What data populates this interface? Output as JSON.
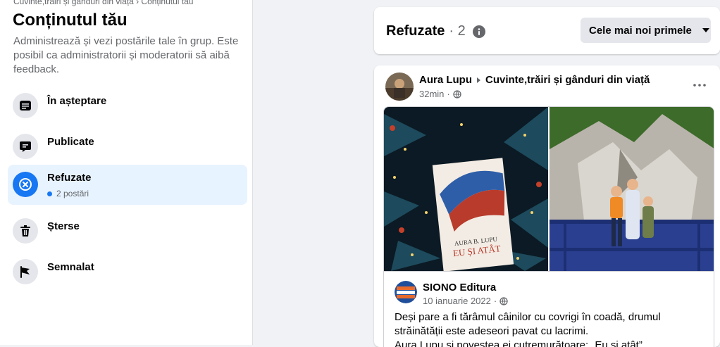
{
  "sidebar": {
    "breadcrumb": "Cuvinte,trăiri și gânduri din viață › Conținutul tău",
    "title": "Conținutul tău",
    "description": "Administrează și vezi postările tale în grup. Este posibil ca administratorii și moderatorii să aibă feedback.",
    "items": [
      {
        "label": "În așteptare",
        "icon": "list-icon"
      },
      {
        "label": "Publicate",
        "icon": "chat-bubble-icon"
      },
      {
        "label": "Refuzate",
        "icon": "x-circle-icon",
        "sub": "2 postări",
        "active": true
      },
      {
        "label": "Șterse",
        "icon": "trash-icon"
      },
      {
        "label": "Semnalat",
        "icon": "flag-icon"
      }
    ]
  },
  "header": {
    "title": "Refuzate",
    "count": "· 2",
    "sort_label": "Cele mai noi primele"
  },
  "post": {
    "author": "Aura Lupu",
    "group": "Cuvinte,trăiri și gânduri din viață",
    "time": "32min",
    "more": "···",
    "shared": {
      "name": "SIONO Editura",
      "date": "10 ianuarie 2022",
      "book_author": "AURA B. LUPU",
      "book_title": "EU ȘI ATÂT",
      "text_line1": "Deși pare a fi tărâmul câinilor cu covrigi în coadă, drumul",
      "text_line2": "străinătății este adeseori pavat cu lacrimi.",
      "text_line3": "Aura Lupu și povestea ei cutremurătoare: „Eu și atât”"
    }
  },
  "colors": {
    "accent": "#1877f2",
    "active_bg": "#e7f3ff",
    "page_bg": "#f0f2f5"
  }
}
